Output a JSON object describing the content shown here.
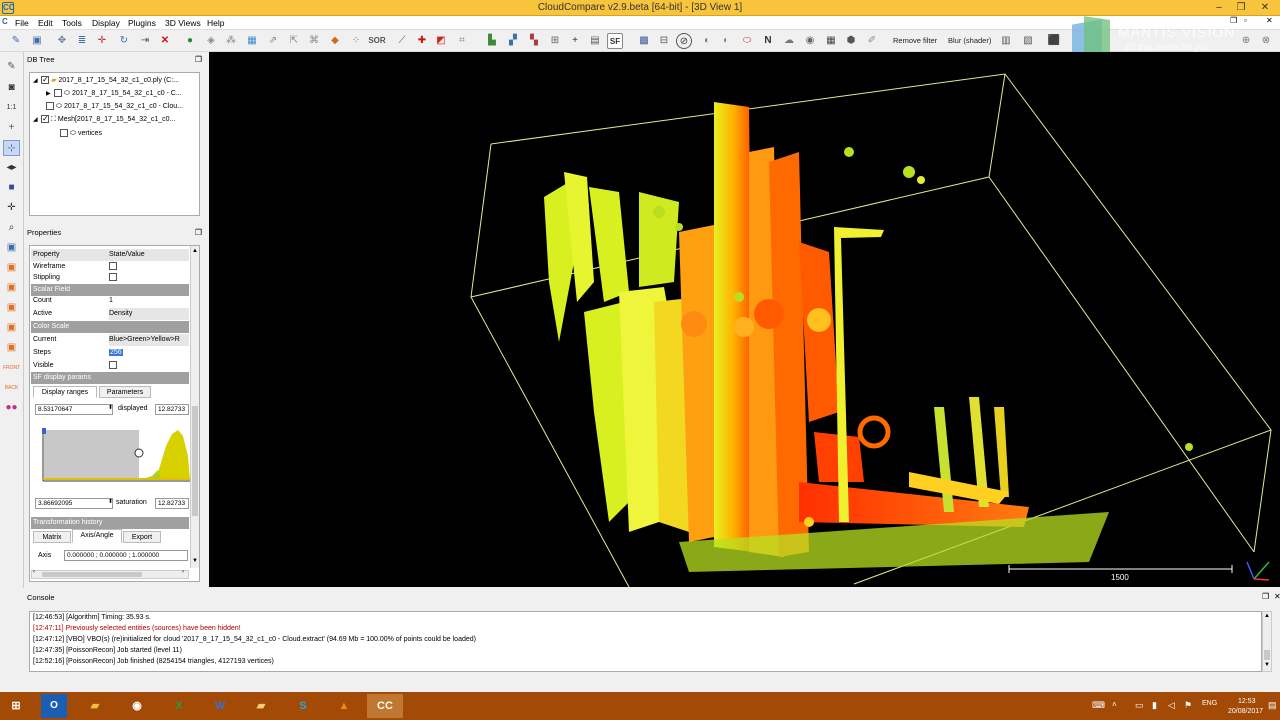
{
  "window": {
    "title": "CloudCompare v2.9.beta [64-bit] - [3D View 1]",
    "app_icon": "CC"
  },
  "menu": [
    "File",
    "Edit",
    "Tools",
    "Display",
    "Plugins",
    "3D Views",
    "Help"
  ],
  "toolbar": {
    "sor_label": "SOR",
    "sf_label": "SF",
    "n_label": "N",
    "remove_filter": "Remove filter",
    "blur_shader": "Blur (shader)"
  },
  "watermark": {
    "line1": "MANTIS VISION",
    "line2": "3D that works for you"
  },
  "dbtree": {
    "title": "DB Tree",
    "items": [
      {
        "label": "2017_8_17_15_54_32_c1_c0.ply (C:...",
        "checked": true
      },
      {
        "label": "2017_8_17_15_54_32_c1_c0 - C...",
        "checked": false
      },
      {
        "label": "2017_8_17_15_54_32_c1_c0 - Clou...",
        "checked": false
      },
      {
        "label": "Mesh[2017_8_17_15_54_32_c1_c0...",
        "checked": true
      },
      {
        "label": "vertices",
        "checked": false
      }
    ]
  },
  "properties": {
    "title": "Properties",
    "header": {
      "property": "Property",
      "value": "State/Value"
    },
    "wireframe": "Wireframe",
    "stippling": "Stippling",
    "scalar_field": "Scalar Field",
    "count": {
      "label": "Count",
      "value": "1"
    },
    "active": {
      "label": "Active",
      "value": "Density"
    },
    "color_scale": "Color Scale",
    "current": {
      "label": "Current",
      "value": "Blue>Green>Yellow>R"
    },
    "steps": {
      "label": "Steps",
      "value": "256"
    },
    "visible": "Visible",
    "sf_display": "SF display params",
    "tabs1": [
      "Display ranges",
      "Parameters"
    ],
    "min_display": "8.53170647",
    "displayed_label": "displayed",
    "displayed_value": "12.82733",
    "min_saturation": "3.86692095",
    "saturation_label": "saturation",
    "saturation_value": "12.82733",
    "transformation_history": "Transformation history",
    "tabs2": [
      "Matrix",
      "Axis/Angle",
      "Export"
    ],
    "axis": {
      "label": "Axis",
      "value": "0.000000 ; 0.000000 ; 1.000000"
    }
  },
  "view": {
    "scale_label": "1500"
  },
  "console": {
    "title": "Console",
    "lines": [
      {
        "text": "[12:46:53] [Algorithm] Timing: 35.93 s.",
        "color": "#000000"
      },
      {
        "text": "[12:47:11] Previously selected entities (sources) have been hidden!",
        "color": "#b00000"
      },
      {
        "text": "[12:47:12] [VBO] VBO(s) (re)initialized for cloud '2017_8_17_15_54_32_c1_c0 - Cloud.extract' (94.69 Mb = 100.00% of points could be loaded)",
        "color": "#000000"
      },
      {
        "text": "[12:47:35] [PoissonRecon] Job started (level 11)",
        "color": "#000000"
      },
      {
        "text": "[12:52:16] [PoissonRecon] Job finished (8254154 triangles, 4127193 vertices)",
        "color": "#000000"
      }
    ]
  },
  "taskbar": {
    "lang": "ENG",
    "time": "12:53",
    "date": "20/08/2017",
    "apps": [
      "windows-icon",
      "outlook-icon",
      "explorer-icon",
      "chrome-icon",
      "excel-icon",
      "word-icon",
      "folder-icon",
      "skype-icon",
      "vlc-icon",
      "cloudcompare-icon"
    ]
  }
}
